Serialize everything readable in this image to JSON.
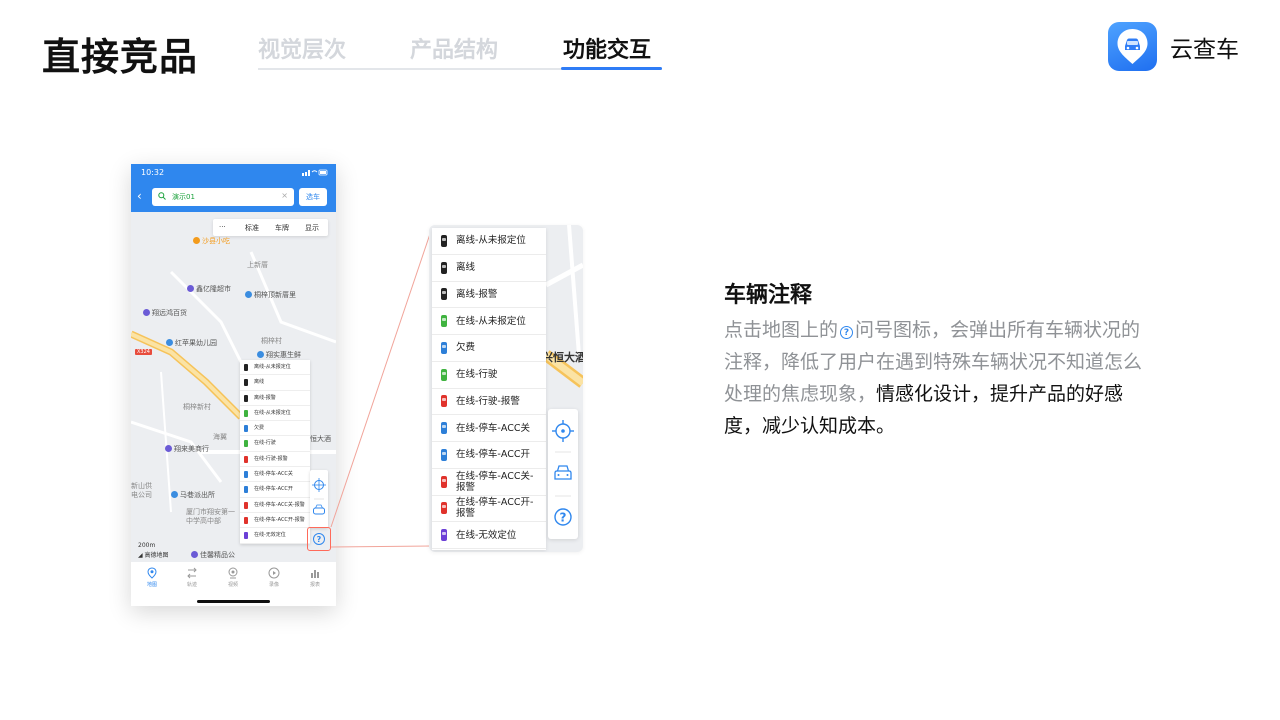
{
  "header": {
    "title": "直接竞品",
    "tabs": [
      {
        "label": "视觉层次",
        "active": false
      },
      {
        "label": "产品结构",
        "active": false
      },
      {
        "label": "功能交互",
        "active": true
      }
    ],
    "brand_name": "云查车",
    "accent": "#2f7cf6"
  },
  "phone": {
    "status_time": "10:32",
    "search_value": "演示01",
    "select_button": "选车",
    "map_menu": {
      "more": "···",
      "items": [
        "标准",
        "车牌",
        "显示"
      ]
    },
    "map_labels": [
      {
        "text": "沙县小吃",
        "color": "#f39b1c"
      },
      {
        "text": "上新厝",
        "color": ""
      },
      {
        "text": "鑫亿隆超市",
        "color": "#6b5bd6"
      },
      {
        "text": "桐梓顶新厝里",
        "color": "#3b8de0"
      },
      {
        "text": "翔远鸿百货",
        "color": "#6b5bd6"
      },
      {
        "text": "红苹果幼儿园",
        "color": "#3b8de0"
      },
      {
        "text": "翔实惠生鲜",
        "color": "#3b8de0"
      },
      {
        "text": "桐梓村",
        "color": ""
      },
      {
        "text": "X324",
        "color": "#e84c3d"
      },
      {
        "text": "桐梓新村",
        "color": ""
      },
      {
        "text": "海翼",
        "color": ""
      },
      {
        "text": "翔来美商行",
        "color": "#6b5bd6"
      },
      {
        "text": "兴恒大酒",
        "color": "#6b5bd6"
      },
      {
        "text": "马巷派出所",
        "color": "#3b8de0"
      },
      {
        "text": "厦门市翔安第一中学高中部",
        "color": "#3b8de0"
      },
      {
        "text": "佳馨精品公",
        "color": "#6b5bd6"
      },
      {
        "text": "新山供电公司",
        "color": ""
      }
    ],
    "scale": "200m",
    "map_brand": "高德地图",
    "list_items": [
      {
        "label": "离线-从未报定位",
        "color": "#222222"
      },
      {
        "label": "离线",
        "color": "#222222"
      },
      {
        "label": "离线-报警",
        "color": "#222222"
      },
      {
        "label": "在线-从未报定位",
        "color": "#3fb33f"
      },
      {
        "label": "欠费",
        "color": "#2d7fd8"
      },
      {
        "label": "在线-行驶",
        "color": "#3fb33f"
      },
      {
        "label": "在线-行驶-报警",
        "color": "#e0322b"
      },
      {
        "label": "在线-停车-ACC关",
        "color": "#2d7fd8"
      },
      {
        "label": "在线-停车-ACC开",
        "color": "#2d7fd8"
      },
      {
        "label": "在线-停车-ACC关-报警",
        "color": "#e0322b"
      },
      {
        "label": "在线-停车-ACC开-报警",
        "color": "#e0322b"
      },
      {
        "label": "在线-无效定位",
        "color": "#6b3fd6"
      }
    ],
    "tabbar": [
      {
        "label": "地图",
        "active": true,
        "icon": "map-pin-icon"
      },
      {
        "label": "轨迹",
        "active": false,
        "icon": "track-icon"
      },
      {
        "label": "视频",
        "active": false,
        "icon": "video-icon"
      },
      {
        "label": "录像",
        "active": false,
        "icon": "playback-icon"
      },
      {
        "label": "报表",
        "active": false,
        "icon": "report-icon"
      }
    ]
  },
  "zoom": {
    "map_text": "兴恒大酒",
    "list_items": [
      {
        "label": "离线-从未报定位",
        "color": "#222222"
      },
      {
        "label": "离线",
        "color": "#222222"
      },
      {
        "label": "离线-报警",
        "color": "#222222"
      },
      {
        "label": "在线-从未报定位",
        "color": "#3fb33f"
      },
      {
        "label": "欠费",
        "color": "#2d7fd8"
      },
      {
        "label": "在线-行驶",
        "color": "#3fb33f"
      },
      {
        "label": "在线-行驶-报警",
        "color": "#e0322b"
      },
      {
        "label": "在线-停车-ACC关",
        "color": "#2d7fd8"
      },
      {
        "label": "在线-停车-ACC开",
        "color": "#2d7fd8"
      },
      {
        "label": "在线-停车-ACC关-报警",
        "color": "#e0322b"
      },
      {
        "label": "在线-停车-ACC开-报警",
        "color": "#e0322b"
      },
      {
        "label": "在线-无效定位",
        "color": "#6b3fd6"
      }
    ]
  },
  "note": {
    "title": "车辆注释",
    "body_part1": "点击地图上的",
    "body_part2": "问号图标，会弹出所有车辆状况的注释，降低了用户在遇到特殊车辆状况不知道怎么处理的焦虑现象，",
    "body_highlight": "情感化设计，提升产品的好感度，减少认知成本。",
    "help_symbol": "?"
  }
}
